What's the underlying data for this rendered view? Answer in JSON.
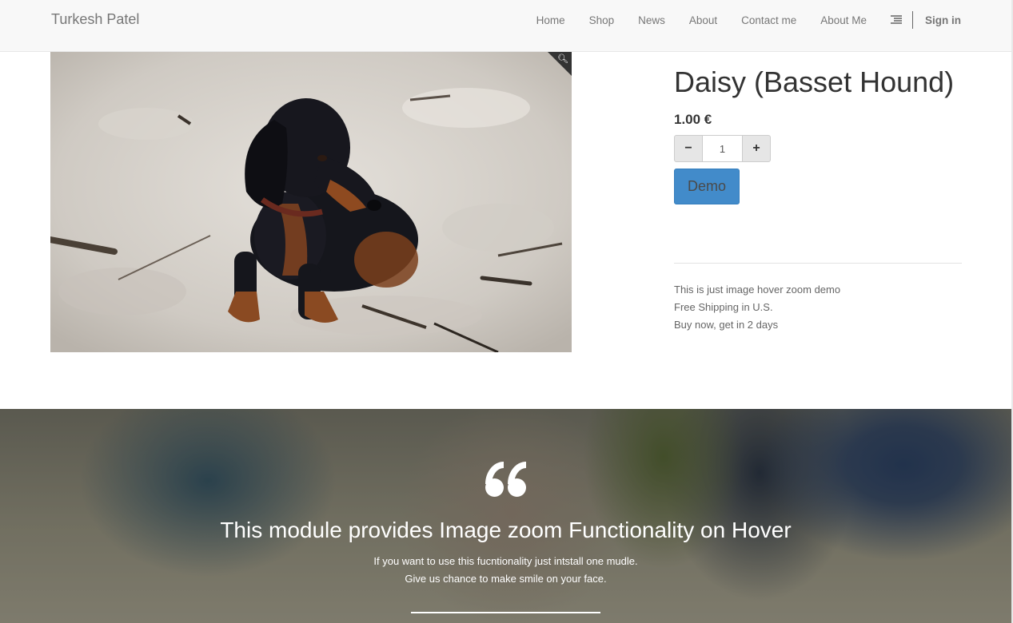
{
  "navbar": {
    "brand": "Turkesh Patel",
    "items": [
      {
        "label": "Home"
      },
      {
        "label": "Shop"
      },
      {
        "label": "News"
      },
      {
        "label": "About"
      },
      {
        "label": "Contact me"
      },
      {
        "label": "About Me"
      }
    ],
    "menu_icon": "list-icon",
    "signin": "Sign in"
  },
  "product": {
    "image_icon": "zoom-magnifier-icon",
    "title": "Daisy (Basset Hound)",
    "price": "1.00 €",
    "quantity": "1",
    "minus_icon": "minus-icon",
    "plus_icon": "plus-icon",
    "demo_label": "Demo",
    "description": [
      "This is just image hover zoom demo",
      "Free Shipping in U.S.",
      "Buy now, get in 2 days"
    ]
  },
  "testimonial": {
    "quote_icon": "quote-icon",
    "title": "This module provides Image zoom Functionality on Hover",
    "line1": "If you want to use this fucntionality just intstall one mudle.",
    "line2": "Give us chance to make smile on your face."
  },
  "colors": {
    "navbar_bg": "#f8f8f8",
    "primary": "#428bca",
    "muted_text": "#777777"
  }
}
